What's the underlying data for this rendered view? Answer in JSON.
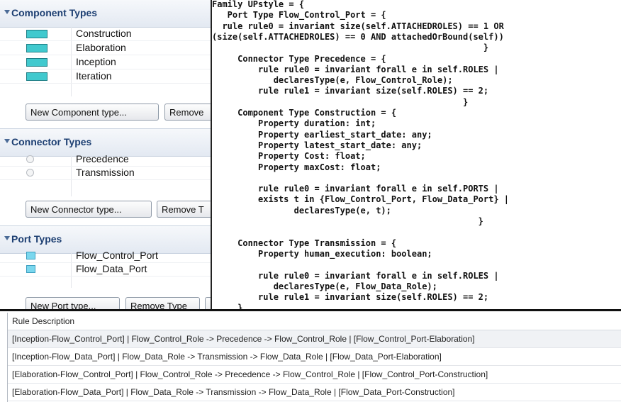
{
  "component_types": {
    "title": "Component Types",
    "items": [
      {
        "label": "Construction",
        "swatch": "#41c9ce"
      },
      {
        "label": "Elaboration",
        "swatch": "#41c9ce"
      },
      {
        "label": "Inception",
        "swatch": "#41c9ce"
      },
      {
        "label": "Iteration",
        "swatch": "#41c9ce"
      }
    ],
    "new_button": "New Component type...",
    "remove_button": "Remove"
  },
  "connector_types": {
    "title": "Connector Types",
    "items": [
      {
        "label": "Precedence"
      },
      {
        "label": "Transmission"
      }
    ],
    "new_button": "New Connector type...",
    "remove_button": "Remove T"
  },
  "port_types": {
    "title": "Port Types",
    "items": [
      {
        "label": "Flow_Control_Port",
        "swatch": "#7ad7ee"
      },
      {
        "label": "Flow_Data_Port",
        "swatch": "#7ad7ee"
      }
    ],
    "new_button": "New Port type...",
    "remove_button": "Remove Type"
  },
  "code_lines": [
    "Family UPstyle = {",
    "   Port Type Flow_Control_Port = {",
    "  rule rule0 = invariant size(self.ATTACHEDROLES) == 1 OR",
    "(size(self.ATTACHEDROLES) == 0 AND attachedOrBound(self))",
    "                                                     }",
    "     Connector Type Precedence = {",
    "         rule rule0 = invariant forall e in self.ROLES |",
    "            declaresType(e, Flow_Control_Role);",
    "         rule rule1 = invariant size(self.ROLES) == 2;",
    "                                                 }",
    "     Component Type Construction = {",
    "         Property duration: int;",
    "         Property earliest_start_date: any;",
    "         Property latest_start_date: any;",
    "         Property Cost: float;",
    "         Property maxCost: float;",
    "",
    "         rule rule0 = invariant forall e in self.PORTS |",
    "         exists t in {Flow_Control_Port, Flow_Data_Port} |",
    "                declaresType(e, t);",
    "                                                    }",
    "",
    "     Connector Type Transmission = {",
    "         Property human_execution: boolean;",
    "",
    "         rule rule0 = invariant forall e in self.ROLES |",
    "            declaresType(e, Flow_Data_Role);",
    "         rule rule1 = invariant size(self.ROLES) == 2;",
    "     }"
  ],
  "rules_table": {
    "header": "Rule Description",
    "rows": [
      "[Inception-Flow_Control_Port] | Flow_Control_Role -> Precedence -> Flow_Control_Role | [Flow_Control_Port-Elaboration]",
      "[Inception-Flow_Data_Port] | Flow_Data_Role -> Transmission -> Flow_Data_Role | [Flow_Data_Port-Elaboration]",
      "[Elaboration-Flow_Control_Port] | Flow_Control_Role -> Precedence -> Flow_Control_Role | [Flow_Control_Port-Construction]",
      "[Elaboration-Flow_Data_Port] | Flow_Data_Role -> Transmission -> Flow_Data_Role | [Flow_Data_Port-Construction]"
    ]
  },
  "colors": {
    "section_title": "#1d3f72",
    "component_swatch": "#41c9ce",
    "port_swatch": "#7ad7ee",
    "code_keyword": "#6b1140"
  }
}
